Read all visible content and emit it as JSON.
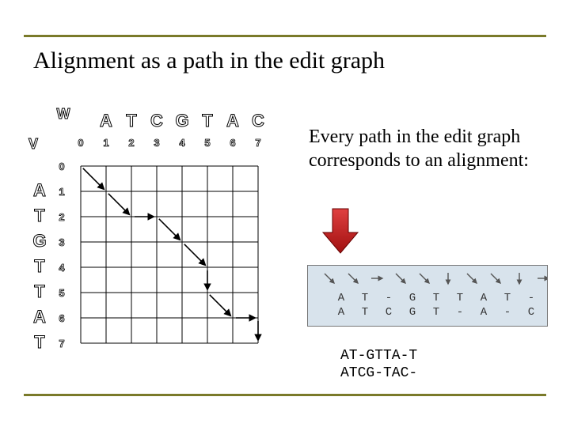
{
  "title": "Alignment as a path in the edit graph",
  "blurb": "Every path in the edit graph corresponds to an alignment:",
  "graph": {
    "w_label": "W",
    "v_label": "V",
    "w_seq": [
      "A",
      "T",
      "C",
      "G",
      "T",
      "A",
      "C"
    ],
    "v_seq": [
      "A",
      "T",
      "G",
      "T",
      "T",
      "A",
      "T"
    ],
    "col_idx": [
      "0",
      "1",
      "2",
      "3",
      "4",
      "5",
      "6",
      "7"
    ],
    "row_idx": [
      "0",
      "1",
      "2",
      "3",
      "4",
      "5",
      "6",
      "7"
    ],
    "path": [
      [
        0,
        0
      ],
      [
        1,
        1
      ],
      [
        2,
        2
      ],
      [
        2,
        3
      ],
      [
        3,
        4
      ],
      [
        4,
        5
      ],
      [
        5,
        5
      ],
      [
        6,
        6
      ],
      [
        6,
        7
      ],
      [
        7,
        7
      ]
    ]
  },
  "panel": {
    "icons": [
      "diag",
      "diag",
      "right",
      "diag",
      "diag",
      "down",
      "diag",
      "diag",
      "down",
      "right"
    ],
    "row1": [
      "A",
      "T",
      "-",
      "G",
      "T",
      "T",
      "A",
      "T",
      "-"
    ],
    "row2": [
      "A",
      "T",
      "C",
      "G",
      "T",
      "-",
      "A",
      "-",
      "C"
    ]
  },
  "mono": {
    "line1": "AT-GTTA-T",
    "line2": "ATCG-TAC-"
  }
}
